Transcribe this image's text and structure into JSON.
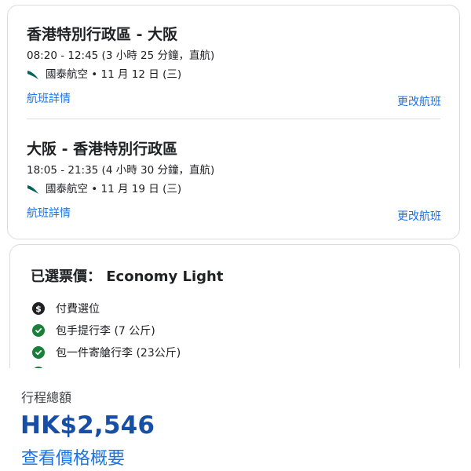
{
  "segments": [
    {
      "route": "香港特別行政區 - 大阪",
      "times": "08:20 - 12:45 (3 小時 25 分鐘，直航)",
      "airline_info": "國泰航空 • 11 月 12 日 (三)",
      "details_link": "航班詳情",
      "change_link": "更改航班"
    },
    {
      "route": "大阪 - 香港特別行政區",
      "times": "18:05 - 21:35 (4 小時 30 分鐘，直航)",
      "airline_info": "國泰航空 • 11 月 19 日 (三)",
      "details_link": "航班詳情",
      "change_link": "更改航班"
    }
  ],
  "fare": {
    "title": "已選票價： Economy Light",
    "features": [
      {
        "icon": "dollar-icon",
        "label": "付費選位"
      },
      {
        "icon": "check-icon",
        "label": "包手提行李 (7 公斤)"
      },
      {
        "icon": "check-icon",
        "label": "包一件寄艙行李 (23公斤)"
      }
    ]
  },
  "summary": {
    "label": "行程總額",
    "price": "HK$2,546",
    "view_breakdown_link": "查看價格概要"
  },
  "colors": {
    "link": "#1a73e8",
    "price": "#174ea6",
    "check": "#188038",
    "airline_logo": "#00645a"
  }
}
